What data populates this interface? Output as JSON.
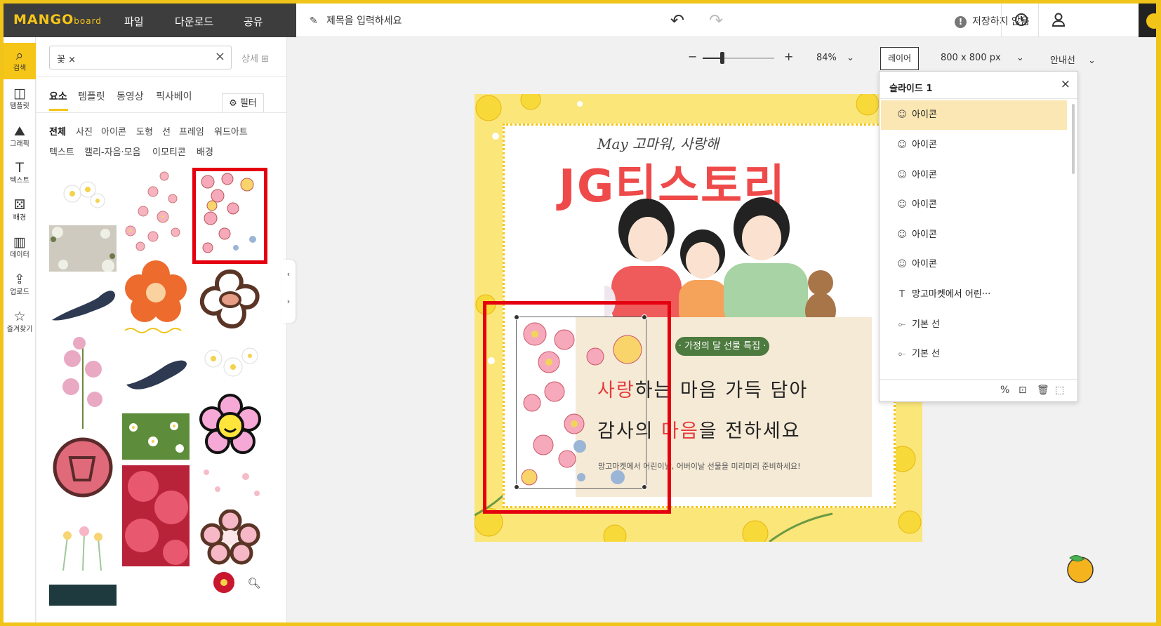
{
  "app": {
    "logo_main": "MANGO",
    "logo_sub": "board",
    "menu": [
      "파일",
      "다운로드",
      "공유"
    ],
    "title_placeholder": "제목을 입력하세요",
    "save_status": "저장하지 않음"
  },
  "rail": [
    {
      "label": "검색",
      "icon": "search-icon"
    },
    {
      "label": "템플릿",
      "icon": "template-icon"
    },
    {
      "label": "그래픽",
      "icon": "graphic-icon"
    },
    {
      "label": "텍스트",
      "icon": "text-icon"
    },
    {
      "label": "배경",
      "icon": "background-icon"
    },
    {
      "label": "데이터",
      "icon": "chart-icon"
    },
    {
      "label": "업로드",
      "icon": "upload-icon"
    },
    {
      "label": "즐겨찾기",
      "icon": "star-icon"
    }
  ],
  "search": {
    "keyword_chip": "꽃 ×",
    "detail_label": "상세"
  },
  "tabs": [
    "요소",
    "템플릿",
    "동영상",
    "픽사베이"
  ],
  "filter_label": "필터",
  "chips_row1": [
    "전체",
    "사진",
    "아이콘",
    "도형",
    "선",
    "프레임",
    "워드아트"
  ],
  "chips_row2": [
    "텍스트",
    "캘리-자음·모음",
    "이모티콘",
    "배경"
  ],
  "canvas_toolbar": {
    "zoom_minus": "−",
    "zoom_plus": "+",
    "zoom": "84%",
    "zoom_level": 0.28,
    "layer_button": "레이어",
    "size": "800 x 800 px",
    "guides": "안내선"
  },
  "slide": {
    "subtitle": "May 고마워, 사랑해",
    "title": "JG티스토리",
    "pill": "· 가정의 달 선물 특집 ·",
    "line1_red": "사랑",
    "line1_rest": "하는 마음 가득 담아",
    "line2_a": "감사의 ",
    "line2_red": "마음",
    "line2_b": "을 전하세요",
    "footnote": "망고마켓에서 어린이날, 어버이날 선물을 미리미리 준비하세요!"
  },
  "layer_panel": {
    "title": "슬라이드 1",
    "rows": [
      {
        "label": "아이콘",
        "icon": "smile-icon",
        "selected": true
      },
      {
        "label": "아이콘",
        "icon": "smile-icon",
        "selected": false
      },
      {
        "label": "아이콘",
        "icon": "smile-icon",
        "selected": false
      },
      {
        "label": "아이콘",
        "icon": "smile-icon",
        "selected": false
      },
      {
        "label": "아이콘",
        "icon": "smile-icon",
        "selected": false
      },
      {
        "label": "아이콘",
        "icon": "smile-icon",
        "selected": false
      },
      {
        "label": "망고마켓에서 어린···",
        "icon": "text-icon",
        "selected": false
      },
      {
        "label": "기본 선",
        "icon": "line-icon",
        "selected": false
      },
      {
        "label": "기본 선",
        "icon": "line-icon",
        "selected": false
      }
    ]
  },
  "colors": {
    "accent": "#f5c518",
    "highlight_red": "#e4000f",
    "title_red": "#ef4a4a",
    "slide_bg": "#fbe679",
    "pill_green": "#4d7a3e"
  }
}
